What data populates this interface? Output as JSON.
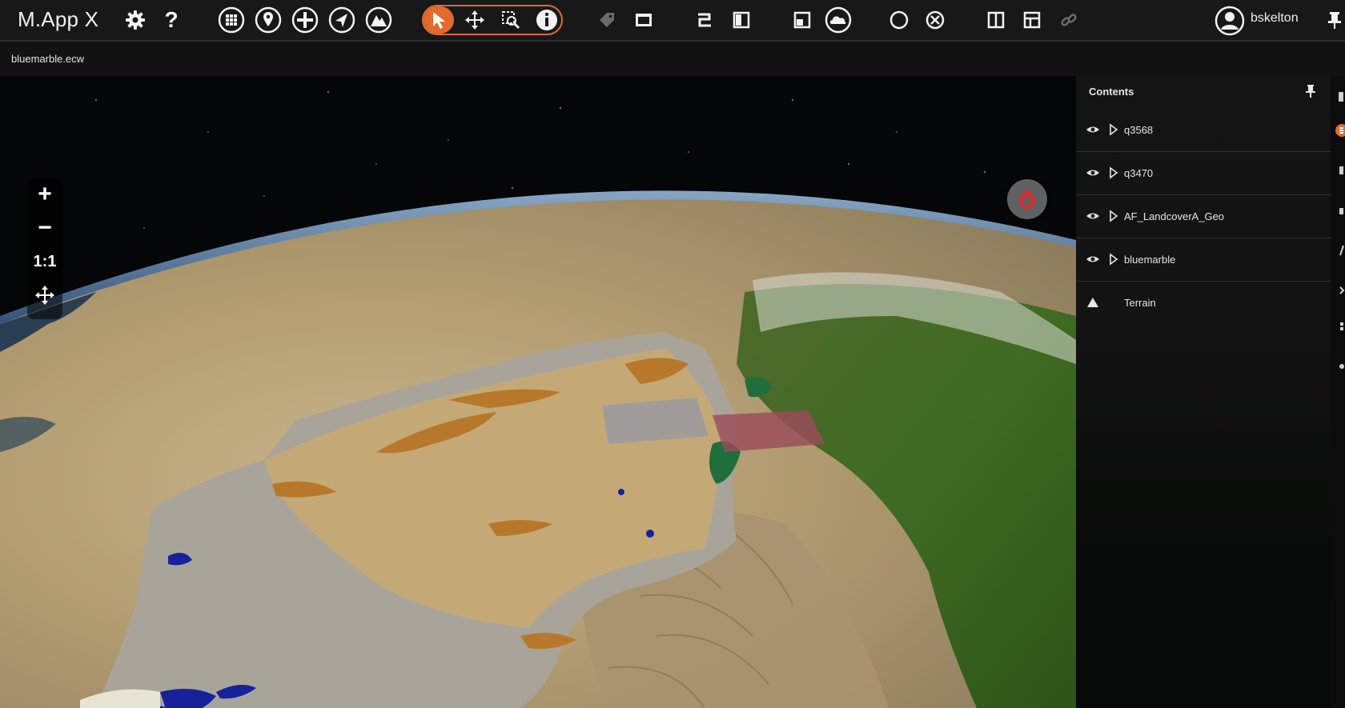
{
  "app": {
    "title": "M.App X"
  },
  "toolbar": {
    "groups": [
      {
        "icons": [
          "settings-gear-icon",
          "help-question-icon"
        ]
      },
      {
        "icons": [
          "grid-icon",
          "placemark-pin-icon",
          "add-circle-icon",
          "navigate-arrow-icon",
          "terrain-peaks-icon"
        ]
      },
      {
        "icons": [
          "select-pointer-icon",
          "pan-move-icon",
          "zoom-area-icon",
          "info-icon"
        ],
        "active": "select-pointer-icon"
      },
      {
        "icons": [
          "tag-icon",
          "window-icon",
          "swipe-icon",
          "split-view-icon",
          "overview-icon",
          "cloud-icon"
        ]
      },
      {
        "icons": [
          "circle-icon",
          "clear-circle-icon"
        ]
      },
      {
        "icons": [
          "columns-icon",
          "frame-icon",
          "link-icon"
        ]
      }
    ],
    "accent_color": "#e26a2c"
  },
  "user": {
    "name": "bskelton",
    "icon": "user-avatar-icon"
  },
  "breadcrumb": {
    "file": "bluemarble.ecw"
  },
  "map_controls": {
    "zoom_in": "+",
    "zoom_out": "−",
    "one_to_one": "1:1",
    "pan_icon": "move-arrows-icon",
    "compass_color": "#e02a2a"
  },
  "contents": {
    "title": "Contents",
    "layers": [
      {
        "name": "q3568",
        "visible": true,
        "expandable": true
      },
      {
        "name": "q3470",
        "visible": true,
        "expandable": true
      },
      {
        "name": "AF_LandcoverA_Geo",
        "visible": true,
        "expandable": true
      },
      {
        "name": "bluemarble",
        "visible": true,
        "expandable": true
      },
      {
        "name": "Terrain",
        "visible": true,
        "expandable": false
      }
    ]
  }
}
